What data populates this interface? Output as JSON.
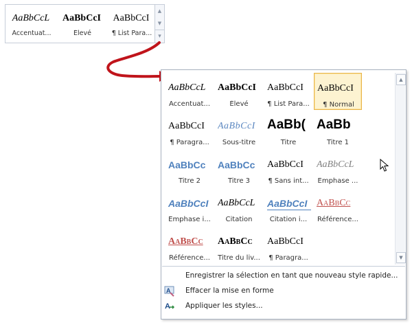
{
  "mini_gallery": {
    "items": [
      {
        "preview": "AaBbCcL",
        "label": "Accentuat...",
        "style": "italic"
      },
      {
        "preview": "AaBbCcI",
        "label": "Élevé",
        "style": "bold"
      },
      {
        "preview": "AaBbCcI",
        "label": "¶ List Para...",
        "style": "normal"
      }
    ],
    "scroll_up": "▲",
    "scroll_down": "▼",
    "more": "▾"
  },
  "panel": {
    "styles": [
      {
        "preview": "AaBbCcL",
        "label": "Accentuat...",
        "variant": "italic",
        "selected": false
      },
      {
        "preview": "AaBbCcI",
        "label": "Élevé",
        "variant": "bold",
        "selected": false
      },
      {
        "preview": "AaBbCcI",
        "label": "¶ List Para...",
        "variant": "normal",
        "selected": false
      },
      {
        "preview": "AaBbCcI",
        "label": "¶ Normal",
        "variant": "normal",
        "selected": true
      },
      {
        "preview": "AaBbCcI",
        "label": "¶ Paragra...",
        "variant": "normal",
        "selected": false
      },
      {
        "preview": "AaBbCcI",
        "label": "Sous-titre",
        "variant": "subtitle",
        "selected": false
      },
      {
        "preview": "AaBb(",
        "label": "Titre",
        "variant": "title",
        "selected": false
      },
      {
        "preview": "AaBb",
        "label": "Titre 1",
        "variant": "title1",
        "selected": false
      },
      {
        "preview": "AaBbCc",
        "label": "Titre 2",
        "variant": "heading-blue",
        "selected": false
      },
      {
        "preview": "AaBbCc",
        "label": "Titre 3",
        "variant": "heading-blue",
        "selected": false
      },
      {
        "preview": "AaBbCcI",
        "label": "¶ Sans int...",
        "variant": "normal",
        "selected": false
      },
      {
        "preview": "AaBbCcL",
        "label": "Emphase ...",
        "variant": "emph-subtle",
        "selected": false
      },
      {
        "preview": "AaBbCcI",
        "label": "Emphase i...",
        "variant": "emph-intense",
        "selected": false
      },
      {
        "preview": "AaBbCcL",
        "label": "Citation",
        "variant": "quote",
        "selected": false
      },
      {
        "preview": "AaBbCcI",
        "label": "Citation i...",
        "variant": "quote-intense",
        "selected": false
      },
      {
        "preview": "AaBbCc",
        "label": "Référence...",
        "variant": "ref-subtle",
        "selected": false
      },
      {
        "preview": "AaBbCc",
        "label": "Référence...",
        "variant": "ref-intense",
        "selected": false
      },
      {
        "preview": "AaBbCc",
        "label": "Titre du liv...",
        "variant": "book",
        "selected": false
      },
      {
        "preview": "AaBbCcI",
        "label": "¶ Paragra...",
        "variant": "normal",
        "selected": false
      }
    ],
    "scroll_up": "▲",
    "scroll_down": "▼",
    "commands": [
      {
        "icon": "",
        "icon_name": "none",
        "label": "Enregistrer la sélection en tant que nouveau style rapide..."
      },
      {
        "icon": "A",
        "icon_name": "clear-formatting-icon",
        "label": "Effacer la mise en forme"
      },
      {
        "icon": "A",
        "icon_name": "apply-styles-icon",
        "label": "Appliquer les styles..."
      }
    ]
  },
  "colors": {
    "arrow": "#c0141b",
    "selected_border": "#e8b44b",
    "selected_fill": "#fdf3d1",
    "accent_blue": "#4f81bd",
    "accent_red": "#c0504d"
  }
}
